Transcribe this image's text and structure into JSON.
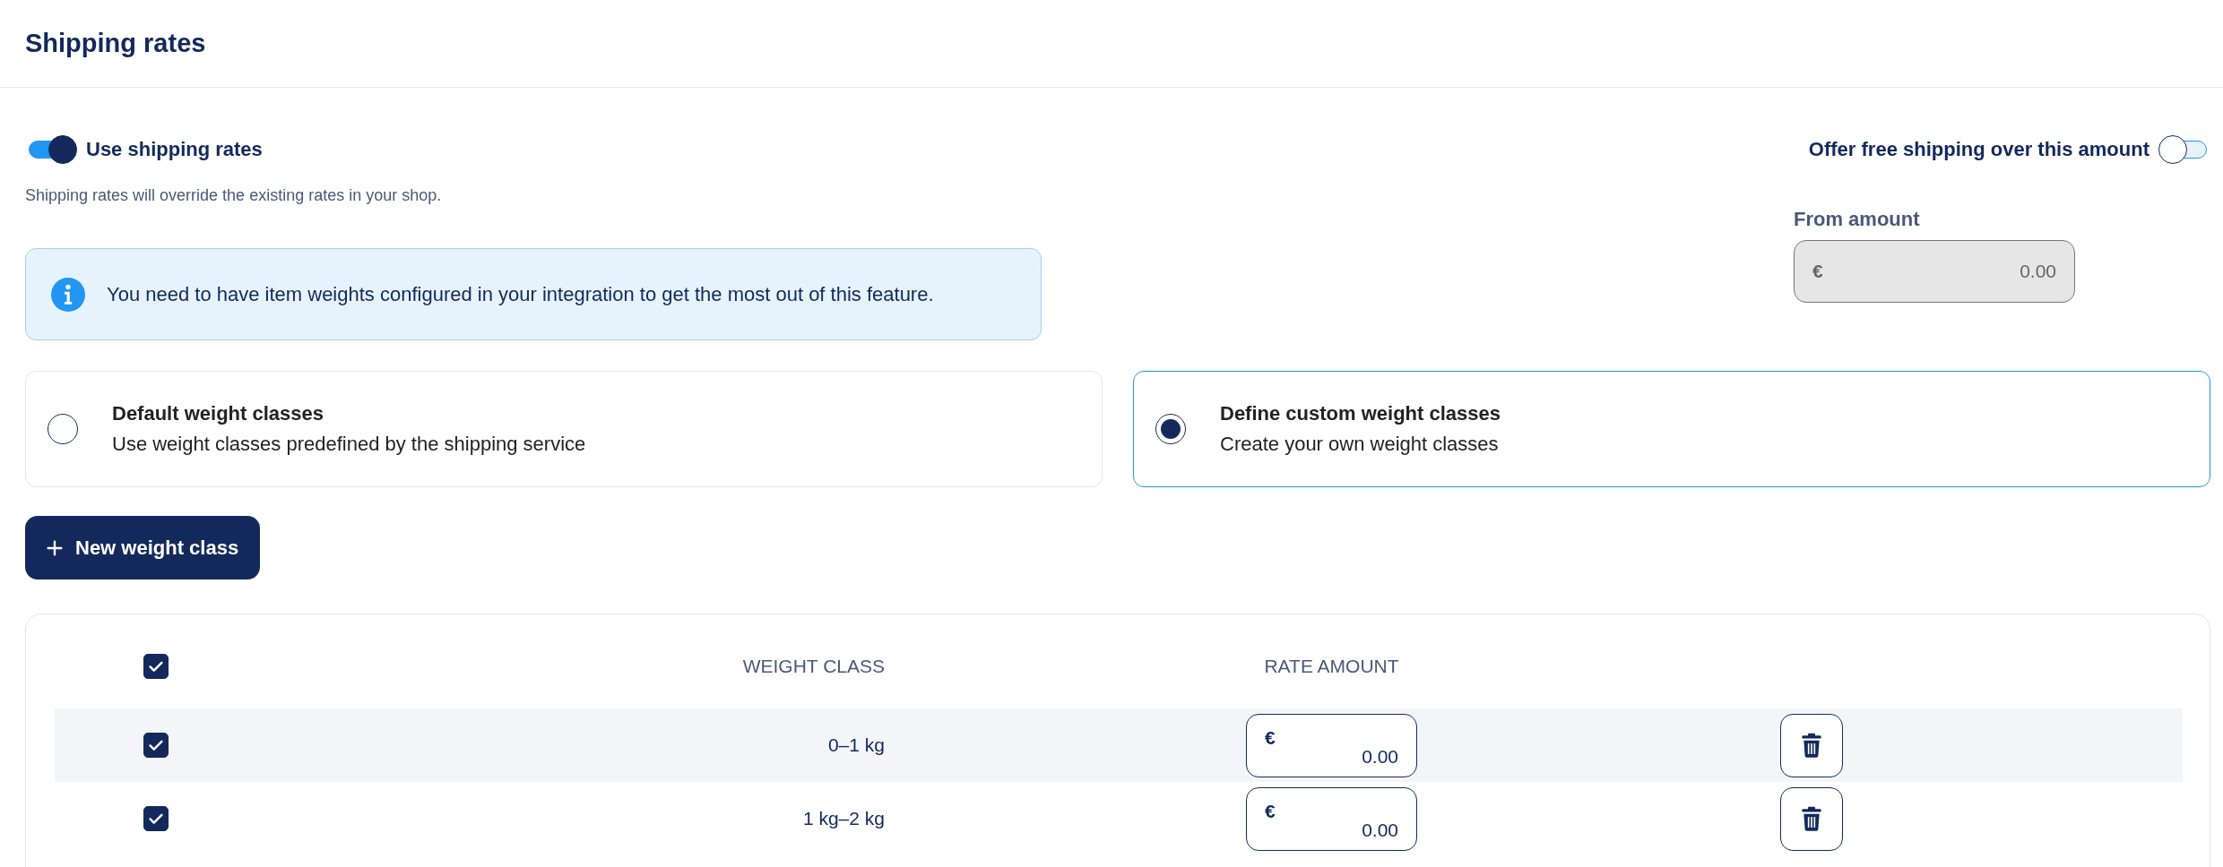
{
  "header": {
    "title": "Shipping rates"
  },
  "use_rates": {
    "label": "Use shipping rates",
    "on": true,
    "help": "Shipping rates will override the existing rates in your shop."
  },
  "info": {
    "text": "You need to have item weights configured in your integration to get the most out of this feature."
  },
  "free_shipping": {
    "label": "Offer free shipping over this amount",
    "on": false,
    "field_label": "From amount",
    "currency": "€",
    "value": "0.00",
    "disabled": true
  },
  "weight_options": [
    {
      "title": "Default weight classes",
      "description": "Use weight classes predefined by the shipping service",
      "selected": false
    },
    {
      "title": "Define custom weight classes",
      "description": "Create your own weight classes",
      "selected": true
    }
  ],
  "new_button": {
    "label": "New weight class"
  },
  "table": {
    "all_checked": true,
    "columns": [
      "WEIGHT CLASS",
      "RATE AMOUNT"
    ],
    "rows": [
      {
        "checked": true,
        "weight_class": "0–1 kg",
        "currency": "€",
        "rate": "0.00"
      },
      {
        "checked": true,
        "weight_class": "1 kg–2 kg",
        "currency": "€",
        "rate": "0.00"
      }
    ]
  }
}
